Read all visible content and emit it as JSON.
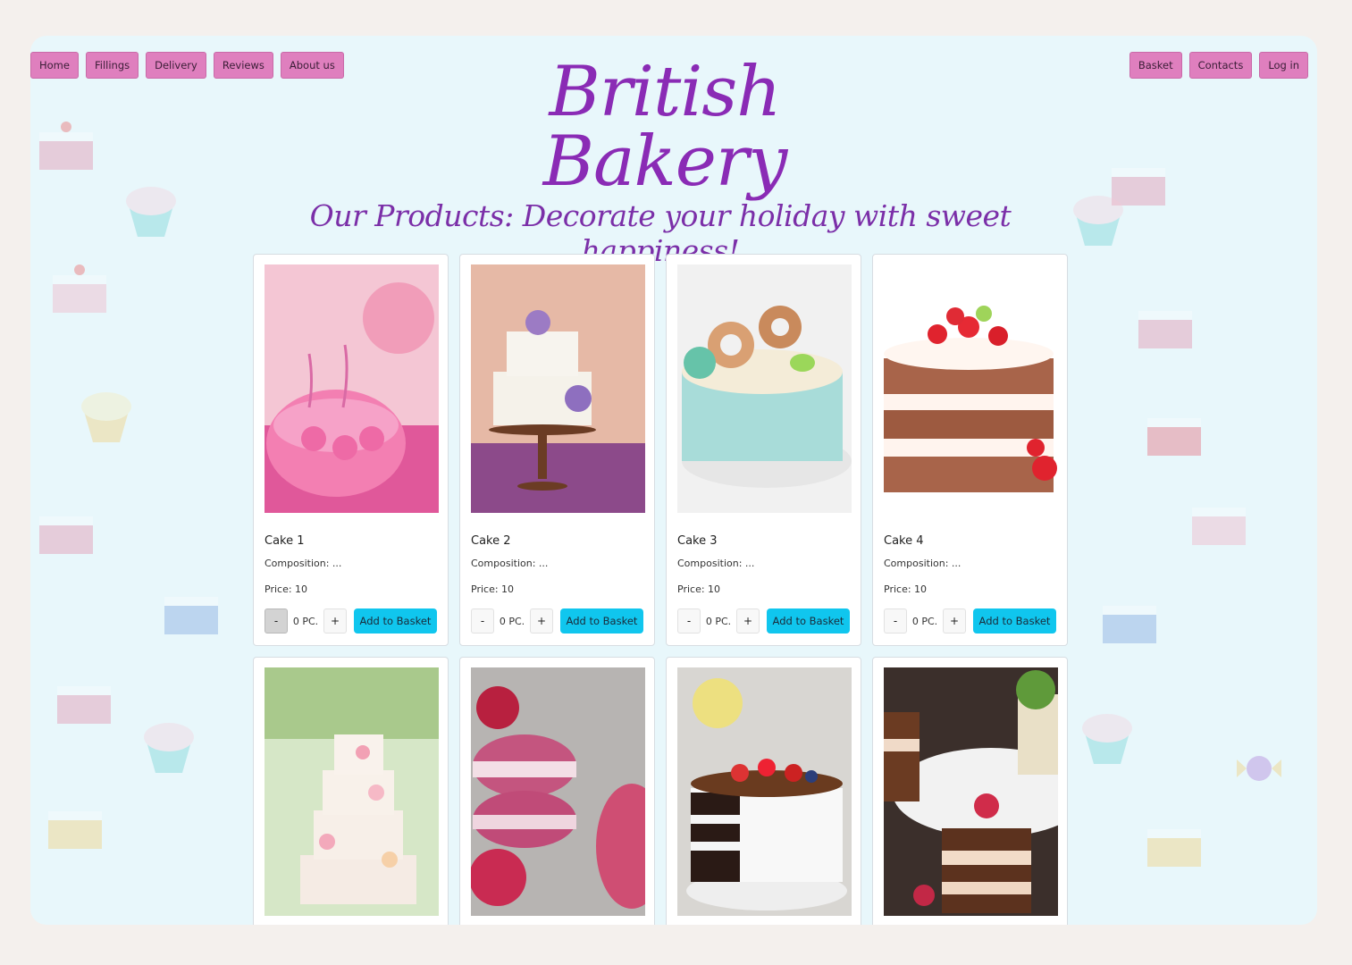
{
  "nav_left": [
    "Home",
    "Fillings",
    "Delivery",
    "Reviews",
    "About us"
  ],
  "nav_right": [
    "Basket",
    "Contacts",
    "Log in"
  ],
  "brand": "British Bakery",
  "tagline": "Our Products: Decorate your holiday with sweet happiness!",
  "products": [
    {
      "name": "Cake 1",
      "composition": "Composition: ...",
      "price": "Price: 10",
      "minus": "-",
      "qty": "0 PC.",
      "plus": "+",
      "add": "Add to Basket"
    },
    {
      "name": "Cake 2",
      "composition": "Composition: ...",
      "price": "Price: 10",
      "minus": "-",
      "qty": "0 PC.",
      "plus": "+",
      "add": "Add to Basket"
    },
    {
      "name": "Cake 3",
      "composition": "Composition: ...",
      "price": "Price: 10",
      "minus": "-",
      "qty": "0 PC.",
      "plus": "+",
      "add": "Add to Basket"
    },
    {
      "name": "Cake 4",
      "composition": "Composition: ...",
      "price": "Price: 10",
      "minus": "-",
      "qty": "0 PC.",
      "plus": "+",
      "add": "Add to Basket"
    }
  ],
  "colors": {
    "nav": "#df7fbe",
    "brand": "#8a2bb5",
    "add_button": "#10c6ee",
    "background": "#e8f7fb"
  }
}
